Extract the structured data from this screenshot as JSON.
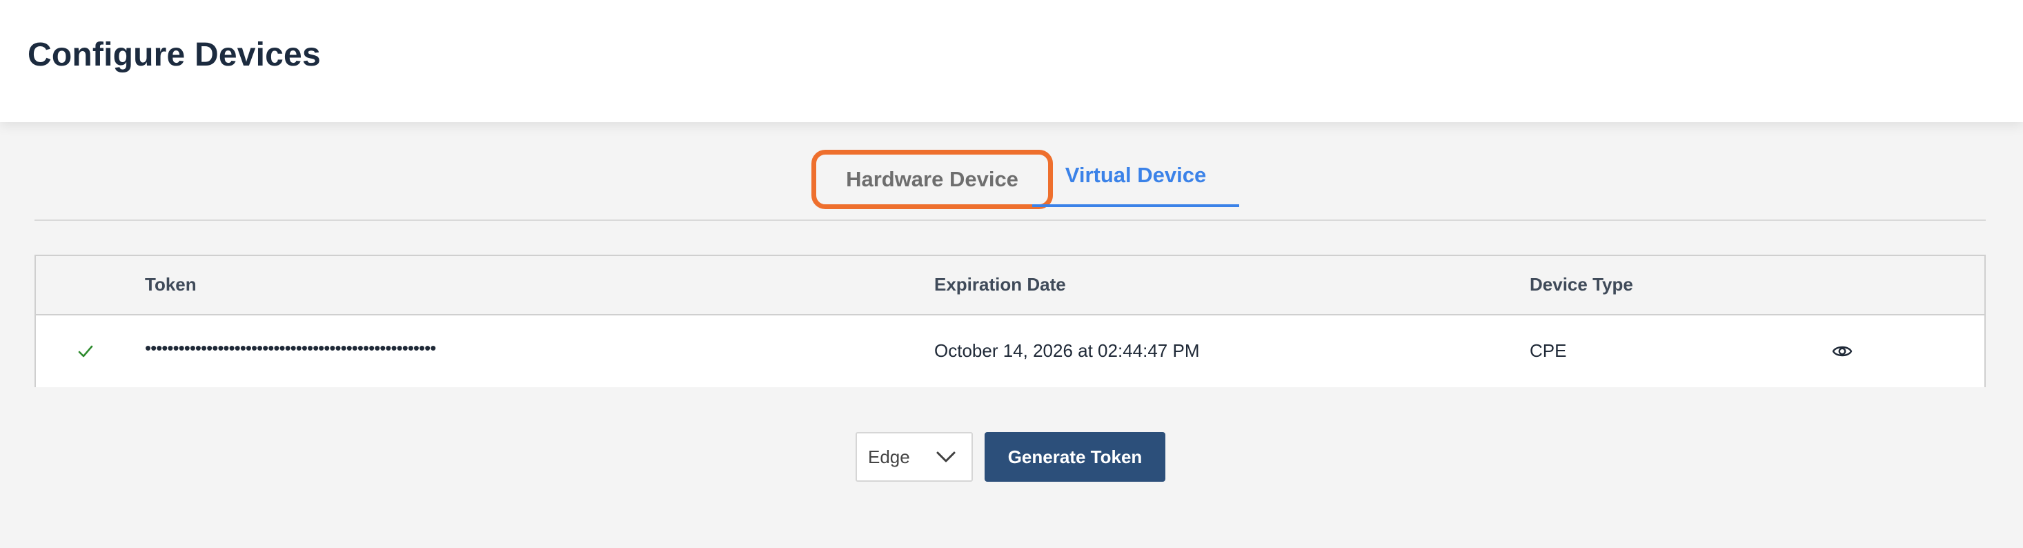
{
  "header": {
    "title": "Configure Devices"
  },
  "tabs": {
    "hardware": "Hardware Device",
    "virtual": "Virtual Device",
    "active": "virtual"
  },
  "table": {
    "columns": {
      "status": "",
      "token": "Token",
      "expiration": "Expiration Date",
      "device_type": "Device Type"
    },
    "rows": [
      {
        "status_icon": "check-icon",
        "token": "••••••••••••••••••••••••••••••••••••••••••••••••••••",
        "expiration": "October 14, 2026 at 02:44:47 PM",
        "device_type": "CPE",
        "action_icon": "eye-icon"
      }
    ]
  },
  "controls": {
    "select_value": "Edge",
    "generate_label": "Generate Token"
  },
  "colors": {
    "accent_blue": "#3b82e8",
    "highlight_orange": "#ee6f2d",
    "button_navy": "#2c4f7a",
    "check_green": "#2e8b2e"
  }
}
